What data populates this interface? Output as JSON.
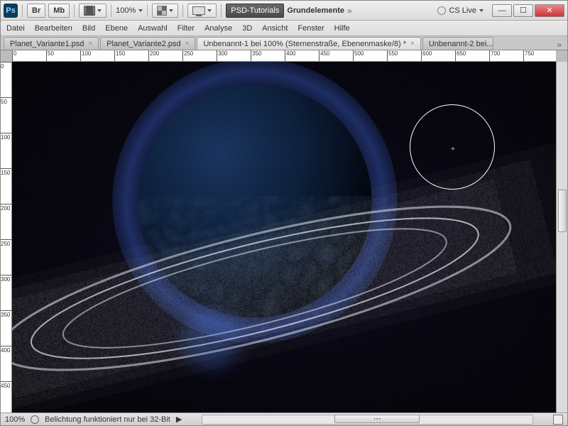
{
  "titlebar": {
    "app": "Ps",
    "br": "Br",
    "mb": "Mb",
    "zoom": "100%",
    "workspace": "PSD-Tutorials",
    "workspace2": "Grundelemente",
    "cslive": "CS Live"
  },
  "menu": [
    "Datei",
    "Bearbeiten",
    "Bild",
    "Ebene",
    "Auswahl",
    "Filter",
    "Analyse",
    "3D",
    "Ansicht",
    "Fenster",
    "Hilfe"
  ],
  "tabs": [
    {
      "label": "Planet_Variante1.psd",
      "active": false
    },
    {
      "label": "Planet_Variante2.psd",
      "active": false
    },
    {
      "label": "Unbenannt-1 bei 100% (Sternenstraße, Ebenenmaske/8) *",
      "active": true
    },
    {
      "label": "Unbenannt-2 bei...",
      "active": false
    }
  ],
  "ruler_h": [
    0,
    50,
    100,
    150,
    200,
    250,
    300,
    350,
    400,
    450,
    500,
    550,
    600,
    650,
    700,
    750
  ],
  "ruler_v": [
    0,
    50,
    100,
    150,
    200,
    250,
    300,
    350,
    400,
    450
  ],
  "status": {
    "zoom": "100%",
    "text": "Belichtung funktioniert nur bei 32-Bit"
  }
}
